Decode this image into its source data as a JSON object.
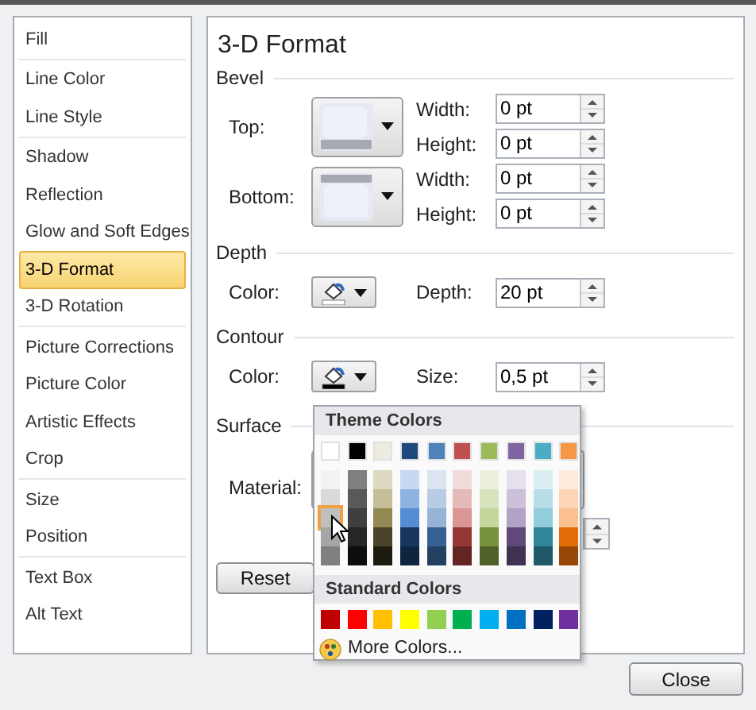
{
  "sidebar": {
    "groups": [
      [
        {
          "label": "Fill",
          "selected": false
        }
      ],
      [
        {
          "label": "Line Color",
          "selected": false
        },
        {
          "label": "Line Style",
          "selected": false
        }
      ],
      [
        {
          "label": "Shadow",
          "selected": false
        },
        {
          "label": "Reflection",
          "selected": false
        },
        {
          "label": "Glow and Soft Edges",
          "selected": false
        },
        {
          "label": "3-D Format",
          "selected": true
        },
        {
          "label": "3-D Rotation",
          "selected": false
        }
      ],
      [
        {
          "label": "Picture Corrections",
          "selected": false
        },
        {
          "label": "Picture Color",
          "selected": false
        },
        {
          "label": "Artistic Effects",
          "selected": false
        },
        {
          "label": "Crop",
          "selected": false
        }
      ],
      [
        {
          "label": "Size",
          "selected": false
        },
        {
          "label": "Position",
          "selected": false
        }
      ],
      [
        {
          "label": "Text Box",
          "selected": false
        },
        {
          "label": "Alt Text",
          "selected": false
        }
      ]
    ]
  },
  "panel": {
    "title": "3-D Format",
    "bevel": {
      "heading": "Bevel",
      "rows": [
        {
          "label": "Top:",
          "kind": "top",
          "width": {
            "label": "Width:",
            "value": "0 pt"
          },
          "height": {
            "label": "Height:",
            "value": "0 pt"
          }
        },
        {
          "label": "Bottom:",
          "kind": "bottom",
          "width": {
            "label": "Width:",
            "value": "0 pt"
          },
          "height": {
            "label": "Height:",
            "value": "0 pt"
          }
        }
      ]
    },
    "depth": {
      "heading": "Depth",
      "color_label": "Color:",
      "color": "#ffffff",
      "value_label": "Depth:",
      "value": "20 pt"
    },
    "contour": {
      "heading": "Contour",
      "color_label": "Color:",
      "color": "#000000",
      "value_label": "Size:",
      "value": "0,5 pt"
    },
    "surface": {
      "heading": "Surface",
      "material_label": "Material:"
    },
    "reset_button": "Reset"
  },
  "color_menu": {
    "theme_heading": "Theme Colors",
    "theme_colors": [
      {
        "color": "#ffffff",
        "selected": false,
        "shades": [
          {
            "color": "#f2f2f2",
            "selected": false
          },
          {
            "color": "#d9d9d9",
            "selected": false
          },
          {
            "color": "#bfbfbf",
            "selected": true
          },
          {
            "color": "#a6a6a6",
            "selected": false
          },
          {
            "color": "#808080",
            "selected": false
          }
        ]
      },
      {
        "color": "#000000",
        "selected": false,
        "shades": [
          {
            "color": "#7f7f7f",
            "selected": false
          },
          {
            "color": "#595959",
            "selected": false
          },
          {
            "color": "#3f3f3f",
            "selected": false
          },
          {
            "color": "#262626",
            "selected": false
          },
          {
            "color": "#0d0d0d",
            "selected": false
          }
        ]
      },
      {
        "color": "#eeece1",
        "selected": false,
        "shades": [
          {
            "color": "#ddd9c3",
            "selected": false
          },
          {
            "color": "#c4bd97",
            "selected": false
          },
          {
            "color": "#938953",
            "selected": false
          },
          {
            "color": "#494429",
            "selected": false
          },
          {
            "color": "#1d1b10",
            "selected": false
          }
        ]
      },
      {
        "color": "#1f497d",
        "selected": false,
        "shades": [
          {
            "color": "#c6d9f0",
            "selected": false
          },
          {
            "color": "#8db3e2",
            "selected": false
          },
          {
            "color": "#548dd4",
            "selected": false
          },
          {
            "color": "#17365d",
            "selected": false
          },
          {
            "color": "#0f243e",
            "selected": false
          }
        ]
      },
      {
        "color": "#4f81bd",
        "selected": false,
        "shades": [
          {
            "color": "#dbe5f1",
            "selected": false
          },
          {
            "color": "#b8cce4",
            "selected": false
          },
          {
            "color": "#95b3d7",
            "selected": false
          },
          {
            "color": "#366092",
            "selected": false
          },
          {
            "color": "#244061",
            "selected": false
          }
        ]
      },
      {
        "color": "#c0504d",
        "selected": false,
        "shades": [
          {
            "color": "#f2dcdb",
            "selected": false
          },
          {
            "color": "#e5b9b7",
            "selected": false
          },
          {
            "color": "#d99694",
            "selected": false
          },
          {
            "color": "#953734",
            "selected": false
          },
          {
            "color": "#632423",
            "selected": false
          }
        ]
      },
      {
        "color": "#9bbb59",
        "selected": false,
        "shades": [
          {
            "color": "#ebf1dd",
            "selected": false
          },
          {
            "color": "#d7e3bc",
            "selected": false
          },
          {
            "color": "#c3d69b",
            "selected": false
          },
          {
            "color": "#76923c",
            "selected": false
          },
          {
            "color": "#4f6128",
            "selected": false
          }
        ]
      },
      {
        "color": "#8064a2",
        "selected": false,
        "shades": [
          {
            "color": "#e5e0ec",
            "selected": false
          },
          {
            "color": "#ccc1d9",
            "selected": false
          },
          {
            "color": "#b2a2c7",
            "selected": false
          },
          {
            "color": "#5f497a",
            "selected": false
          },
          {
            "color": "#3f3151",
            "selected": false
          }
        ]
      },
      {
        "color": "#4bacc6",
        "selected": false,
        "shades": [
          {
            "color": "#dbeef3",
            "selected": false
          },
          {
            "color": "#b7dde8",
            "selected": false
          },
          {
            "color": "#92cddc",
            "selected": false
          },
          {
            "color": "#31859b",
            "selected": false
          },
          {
            "color": "#205867",
            "selected": false
          }
        ]
      },
      {
        "color": "#f79646",
        "selected": false,
        "shades": [
          {
            "color": "#fdeada",
            "selected": false
          },
          {
            "color": "#fbd5b5",
            "selected": false
          },
          {
            "color": "#fac08f",
            "selected": false
          },
          {
            "color": "#e36c09",
            "selected": false
          },
          {
            "color": "#974806",
            "selected": false
          }
        ]
      }
    ],
    "standard_heading": "Standard Colors",
    "standard_colors": [
      {
        "color": "#c00000",
        "selected": false
      },
      {
        "color": "#ff0000",
        "selected": false
      },
      {
        "color": "#ffc000",
        "selected": false
      },
      {
        "color": "#ffff00",
        "selected": false
      },
      {
        "color": "#92d050",
        "selected": false
      },
      {
        "color": "#00b050",
        "selected": false
      },
      {
        "color": "#00b0f0",
        "selected": false
      },
      {
        "color": "#0070c0",
        "selected": false
      },
      {
        "color": "#002060",
        "selected": false
      },
      {
        "color": "#7030a0",
        "selected": false
      }
    ],
    "more_colors": "More Colors..."
  },
  "close_button": "Close"
}
